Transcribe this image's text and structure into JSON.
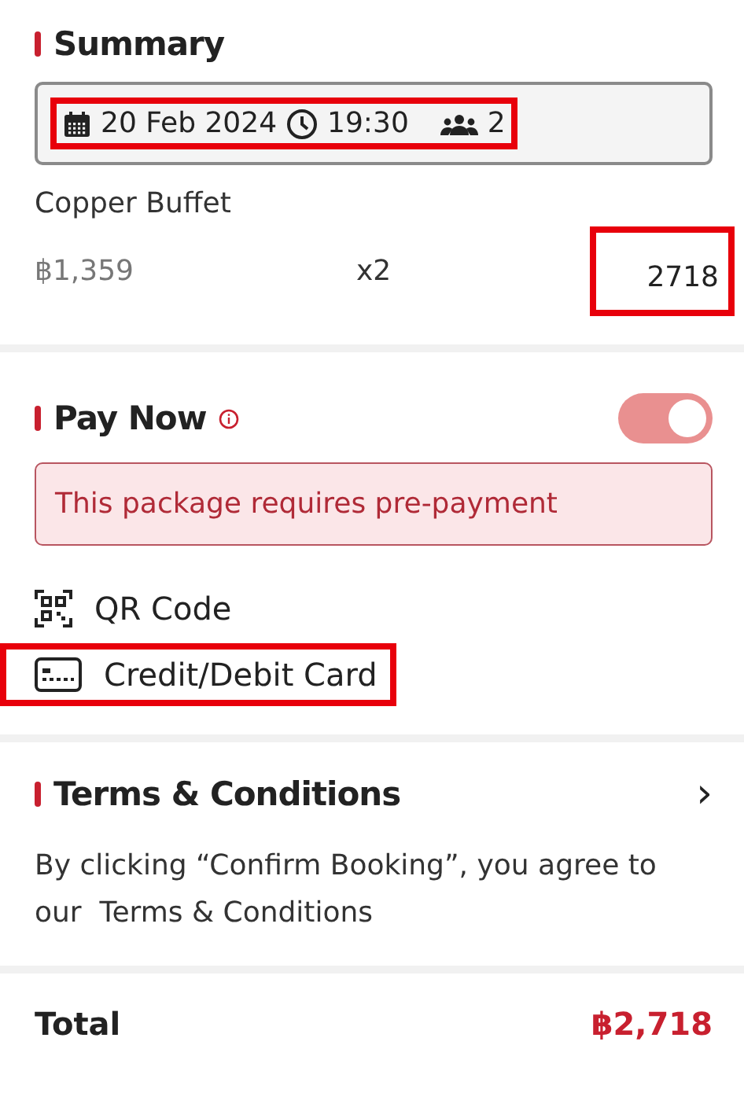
{
  "summary": {
    "title": "Summary",
    "booking": {
      "date": "20 Feb 2024",
      "time": "19:30",
      "guests": "2",
      "highlighted": true
    },
    "items": [
      {
        "name": "Copper Buffet",
        "price": "฿1,359",
        "quantity": "x2",
        "total": "2718",
        "total_highlighted": true
      }
    ]
  },
  "pay_now": {
    "title": "Pay Now",
    "on": true,
    "notice": "This package requires pre-payment",
    "methods": [
      {
        "kind": "qr",
        "label": "QR Code",
        "highlighted": false
      },
      {
        "kind": "card",
        "label": "Credit/Debit Card",
        "highlighted": true
      }
    ]
  },
  "terms": {
    "title": "Terms & Conditions",
    "chevron": "›",
    "text": "By clicking “Confirm Booking”, you agree to our  Terms & Conditions"
  },
  "total": {
    "label": "Total",
    "amount": "฿2,718"
  }
}
